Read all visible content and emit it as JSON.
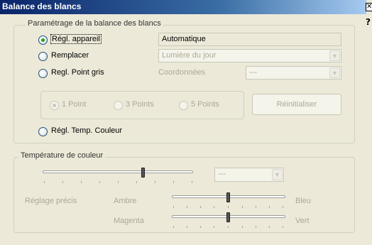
{
  "window": {
    "title": "Balance des blancs",
    "close_glyph": "✕",
    "help_glyph": "?"
  },
  "settings_group": {
    "legend": "Paramétrage de la balance des blancs",
    "options": {
      "camera": {
        "label": "Régl. appareil",
        "value": "Automatique"
      },
      "replace": {
        "label": "Remplacer",
        "value": "Lumière du jour"
      },
      "gray_point": {
        "label": "Regl. Point gris",
        "coords_label": "Coordonnées",
        "coords_value": "---"
      },
      "color_temp": {
        "label": "Régl. Temp. Couleur"
      }
    },
    "point_options": [
      "1 Point",
      "3 Points",
      "5 Points"
    ],
    "reset_label": "Réinitialiser"
  },
  "temperature_group": {
    "legend": "Température de couleur",
    "value": "---",
    "fine_tuning_label": "Réglage précis",
    "amber_label": "Ambre",
    "blue_label": "Bleu",
    "magenta_label": "Magenta",
    "green_label": "Vert"
  },
  "colors": {
    "title_start": "#0a246a",
    "title_end": "#a6caf0",
    "radio_check": "#21a121"
  }
}
